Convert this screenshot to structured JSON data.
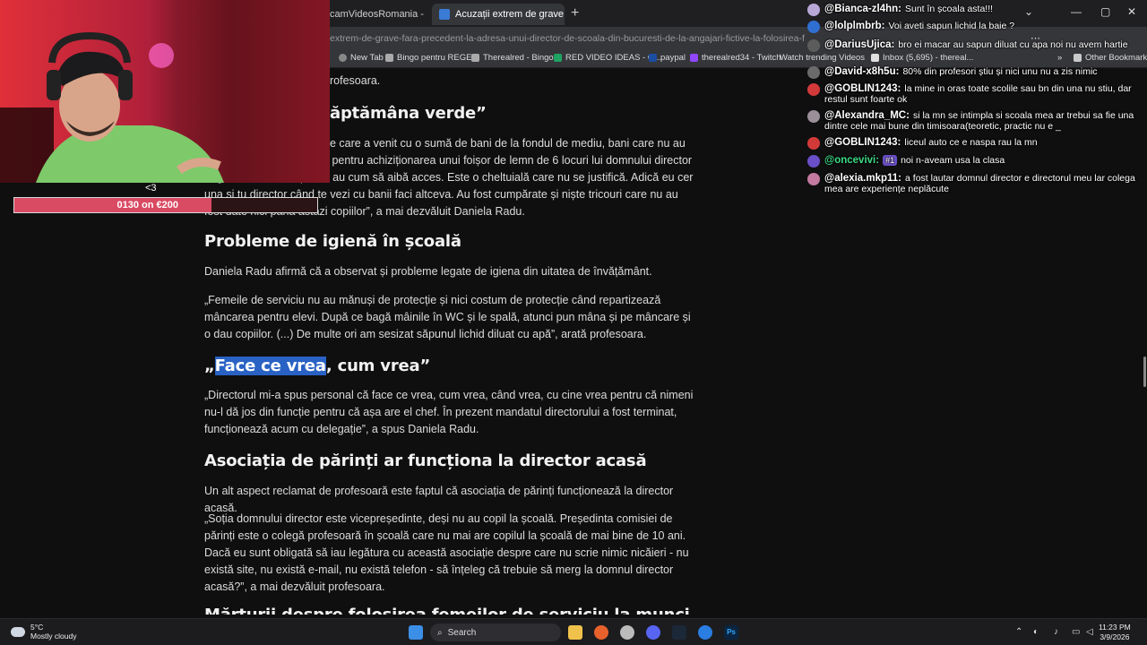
{
  "browser": {
    "tabs": [
      {
        "label": "camVideosRomania - YouT"
      },
      {
        "label": "Acuzații extrem de grave, fără p"
      }
    ],
    "new_tab": "+",
    "url": "extrem-de-grave-fara-precedent-la-adresa-unui-director-de-scoala-din-bucuresti-de-la-angajari-fictive-la-folosirea-femeilor-de-serviciu-in-s",
    "bookmarks": [
      "New Tab",
      "Bingo pentru REGE",
      "Therealred - Bingos",
      "RED VIDEO IDEAS - G...",
      "paypal",
      "therealred34 - Twitch",
      "Watch trending Videos...",
      "Inbox (5,695) - thereal...",
      "Other Bookmarks"
    ],
    "window_controls": [
      "⌄",
      "—",
      "▢",
      "✕"
    ]
  },
  "article": {
    "top_fragment": "rofesoara.",
    "heading_green": "ăptămâna verde”",
    "para1": "e care a venit cu o sumă de bani de la fondul de mediu, bani care nu au ajuns , banii fiind cheltuiți pentru achiziționarea unui foișor de lemn de 6 locuri lui domnului director în grădină, unde copiii nu au cum să aibă acces. Este o cheltuială care nu se justifică. Adică eu cer una și tu director când te vezi cu banii faci altceva. Au fost cumpărate și niște tricouri care nu au fost date nici până astăzi copiilor”, a mai dezvăluit Daniela Radu.",
    "heading_hygiene": "Probleme de igienă în școală",
    "para2": "Daniela Radu afirmă că a observat și probleme legate de igiena din uitatea de învățământ.",
    "para3": "„Femeile de serviciu nu au mănuși de protecție și nici costum de protecție când repartizează mâncarea pentru elevi. După ce bagă mâinile în WC și le spală, atunci pun mâna și pe mâncare și o dau copiilor. (...) De multe ori am sesizat săpunul lichid diluat cu apă”, arată profesoara.",
    "heading_face_hl": "Face ce vrea",
    "heading_face_prefix": "„",
    "heading_face_rest": ", cum vrea”",
    "para4": "„Directorul mi-a spus personal că face ce vrea, cum vrea, când vrea, cu cine vrea pentru că nimeni nu-l dă jos din funcție pentru că așa are el chef. În prezent mandatul directorului a fost terminat, funcționează acum cu delegație”, a spus Daniela Radu.",
    "heading_assoc": "Asociația de părinți ar funcționa la director acasă",
    "para5": "Un alt aspect reclamat de profesoară este faptul că asociația de părinți funcționează la director acasă.",
    "para6": "„Soția domnului director este vicepreședinte, deși nu au copil la școală. Președinta comisiei de părinți este o colegă profesoară în școală care nu mai are copilul la școală de mai bine de 10 ani. Dacă eu sunt obligată să iau legătura cu această asociație despre care nu scrie nimic nicăieri - nu există site, nu există e-mail, nu există telefon - să înțeleg că trebuie să merg la domnul director acasă?”, a mai dezvăluit profesoara.",
    "heading_cut": "Mărturii despre folosirea femeilor de serviciu la munci"
  },
  "overlay": {
    "heart": "<3",
    "goal_text": "0130 on €200",
    "goal_fraction": 0.65
  },
  "chat": [
    {
      "user": "@Bianca-zl4hn:",
      "text": "Sunt în școala asta!!!",
      "color": "#b9a7d8",
      "name_color": "#ffffff"
    },
    {
      "user": "@lolplmbrb:",
      "text": "Voi aveti sapun lichid la baie ?",
      "color": "#2f6fd1",
      "name_color": "#ffffff"
    },
    {
      "user": "@DariusUjica:",
      "text": "bro ei macar au sapun diluat cu apa noi nu avem hartie",
      "color": "#5c5c5c",
      "name_color": "#ffffff"
    },
    {
      "user": "@David-x8h5u:",
      "text": "80% din profesori știu și nici unu nu a zis nimic",
      "color": "#6b6b6b",
      "name_color": "#ffffff"
    },
    {
      "user": "@GOBLIN1243:",
      "text": "la mine in oras toate scolile sau bn din una nu stiu, dar restul sunt foarte ok",
      "color": "#d23a3a",
      "name_color": "#ffffff"
    },
    {
      "user": "@Alexandra_MC:",
      "text": "si la mn se intimpla si scoala mea ar trebui sa fie una dintre cele mai bune din timisoara(teoretic, practic nu e _",
      "color": "#9b8f99",
      "name_color": "#ffffff"
    },
    {
      "user": "@GOBLIN1243:",
      "text": "liceul auto ce e naspa rau la mn",
      "color": "#d23a3a",
      "name_color": "#ffffff"
    },
    {
      "user": "@oncevivi:",
      "text": "noi n-aveam usa la clasa",
      "color": "#6a4fc8",
      "name_color": "#3ddc84",
      "badge": "#1"
    },
    {
      "user": "@alexia.mkp11:",
      "text": "a fost lautar domnul director e directorul meu lar colega mea are experiențe neplăcute",
      "color": "#c47aa0",
      "name_color": "#ffffff"
    }
  ],
  "taskbar": {
    "temp": "5°C",
    "weather": "Mostly cloudy",
    "search": "Search",
    "time": "11:23 PM",
    "date": "3/9/2026"
  }
}
